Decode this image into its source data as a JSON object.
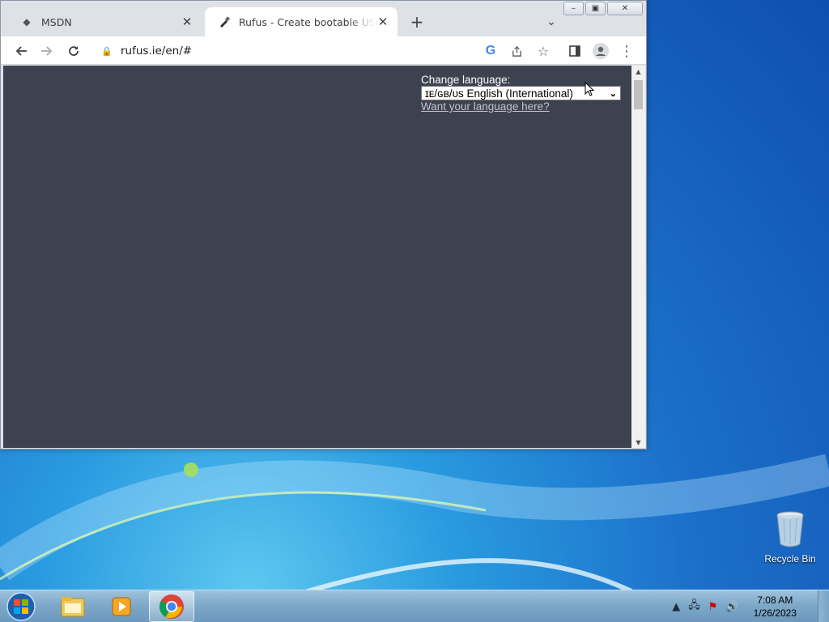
{
  "browser": {
    "tabs": [
      {
        "title": "MSDN",
        "icon": "msdn-diamond-icon"
      },
      {
        "title": "Rufus - Create bootable USB drive",
        "icon": "usb-key-icon",
        "active": true
      }
    ],
    "url": "rufus.ie/en/#"
  },
  "page": {
    "change_language_label": "Change language:",
    "language_selected": "ɪᴇ/ɢʙ/ᴜs English (International)",
    "language_link": "Want your language here?",
    "background": "#3d4250"
  },
  "desktop": {
    "recycle_bin_label": "Recycle Bin"
  },
  "taskbar": {
    "clock_time": "7:08 AM",
    "clock_date": "1/26/2023"
  }
}
